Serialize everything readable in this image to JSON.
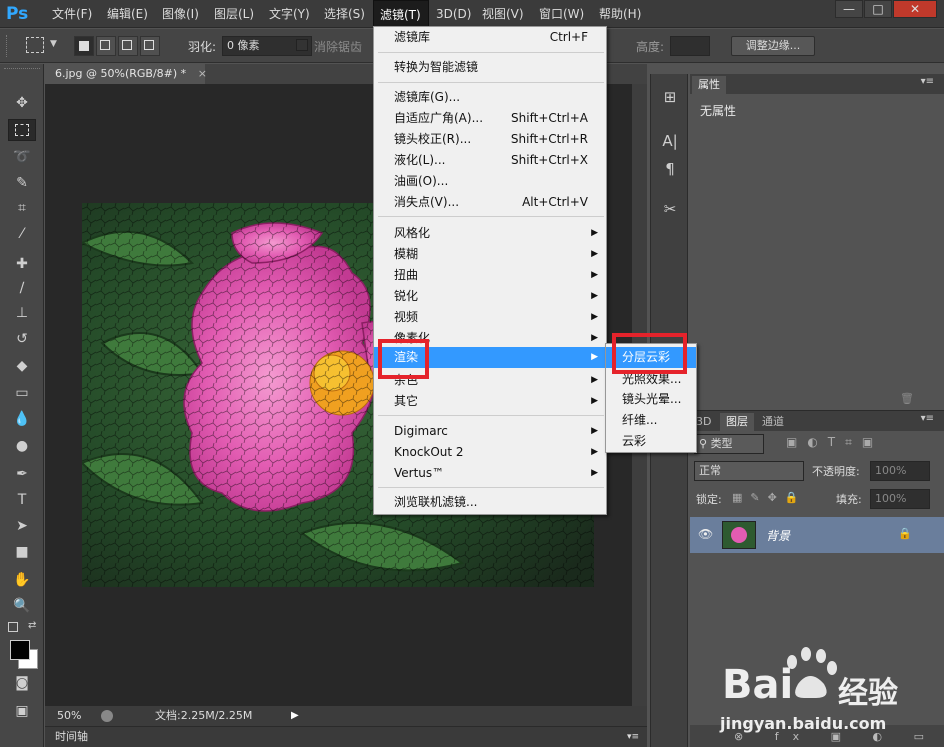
{
  "app": {
    "logo": "Ps"
  },
  "menubar": {
    "items": [
      "文件(F)",
      "编辑(E)",
      "图像(I)",
      "图层(L)",
      "文字(Y)",
      "选择(S)",
      "滤镜(T)",
      "3D(D)",
      "视图(V)",
      "窗口(W)",
      "帮助(H)"
    ],
    "active": "滤镜(T)"
  },
  "window_controls": {
    "minimize": "—",
    "maximize": "□",
    "close": "✕"
  },
  "options_bar": {
    "feather_label": "羽化:",
    "feather_value": "0 像素",
    "antialias_label": "消除锯齿",
    "height_label": "高度:",
    "refine_edge": "调整边缘..."
  },
  "document": {
    "tab_title": "6.jpg @ 50%(RGB/8#) *",
    "tab_close": "×",
    "zoom": "50%",
    "doc_size": "文档:2.25M/2.25M"
  },
  "timeline": {
    "label": "时间轴"
  },
  "properties_panel": {
    "tab": "属性",
    "content": "无属性"
  },
  "layers_panel": {
    "tabs": [
      "3D",
      "图层",
      "通道"
    ],
    "filter_kind": "类型",
    "blend_mode": "正常",
    "opacity_label": "不透明度:",
    "opacity_value": "100%",
    "lock_label": "锁定:",
    "fill_label": "填充:",
    "fill_value": "100%",
    "layer_name": "背景"
  },
  "filter_menu": {
    "items": [
      {
        "label": "滤镜库",
        "shortcut": "Ctrl+F"
      },
      {
        "label": "转换为智能滤镜"
      },
      {
        "label": "滤镜库(G)..."
      },
      {
        "label": "自适应广角(A)...",
        "shortcut": "Shift+Ctrl+A"
      },
      {
        "label": "镜头校正(R)...",
        "shortcut": "Shift+Ctrl+R"
      },
      {
        "label": "液化(L)...",
        "shortcut": "Shift+Ctrl+X"
      },
      {
        "label": "油画(O)..."
      },
      {
        "label": "消失点(V)...",
        "shortcut": "Alt+Ctrl+V"
      },
      {
        "label": "风格化"
      },
      {
        "label": "模糊"
      },
      {
        "label": "扭曲"
      },
      {
        "label": "锐化"
      },
      {
        "label": "视频"
      },
      {
        "label": "像素化"
      },
      {
        "label": "渲染"
      },
      {
        "label": "杂色"
      },
      {
        "label": "其它"
      },
      {
        "label": "Digimarc"
      },
      {
        "label": "KnockOut 2"
      },
      {
        "label": "Vertus™"
      },
      {
        "label": "浏览联机滤镜..."
      }
    ],
    "highlighted": "渲染"
  },
  "render_submenu": {
    "items": [
      "分层云彩",
      "光照效果...",
      "镜头光晕...",
      "纤维...",
      "云彩"
    ],
    "highlighted": "分层云彩"
  },
  "watermark": {
    "brand": "Bai",
    "brand2": "经验",
    "url": "jingyan.baidu.com"
  },
  "colors": {
    "accent": "#3399ff",
    "highlight_box": "#e5232b",
    "ps_blue": "#31a8ff"
  }
}
